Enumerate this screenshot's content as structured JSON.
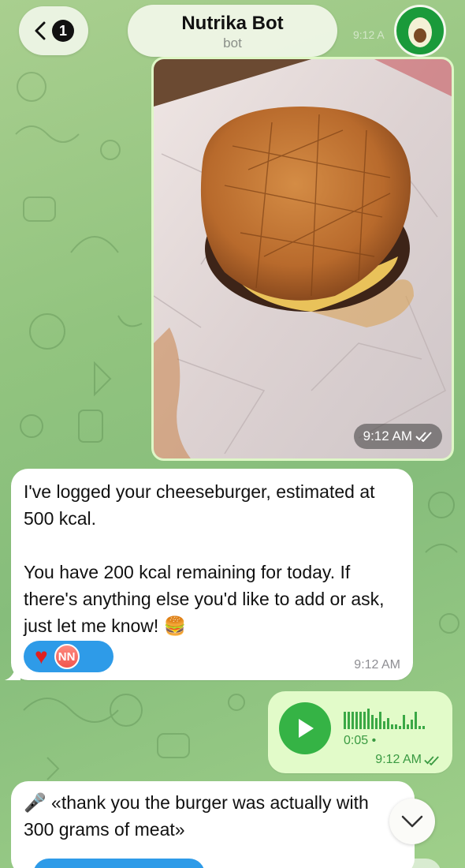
{
  "header": {
    "back_badge": "1",
    "title": "Nutrika Bot",
    "subtitle": "bot",
    "faded_time": "9:12 A"
  },
  "photo_message": {
    "time": "9:12 AM",
    "status_icon": "double-check-icon"
  },
  "bot_reply": {
    "text": "I've logged your cheeseburger, estimated at 500 kcal.\n\nYou have 200 kcal remaining for today. If there's anything else you'd like to add or ask, just let me know! 🍔",
    "reaction_emoji": "♥",
    "reaction_user": "NN",
    "time": "9:12 AM"
  },
  "voice_message": {
    "duration": "0:05",
    "time": "9:12 AM"
  },
  "transcription": {
    "text": "🎤 «thank you the burger was actually with 300 grams of meat»"
  },
  "colors": {
    "accent_blue": "#2e9be8",
    "voice_green": "#35b345",
    "outgoing_bubble": "#e2fbc9"
  }
}
